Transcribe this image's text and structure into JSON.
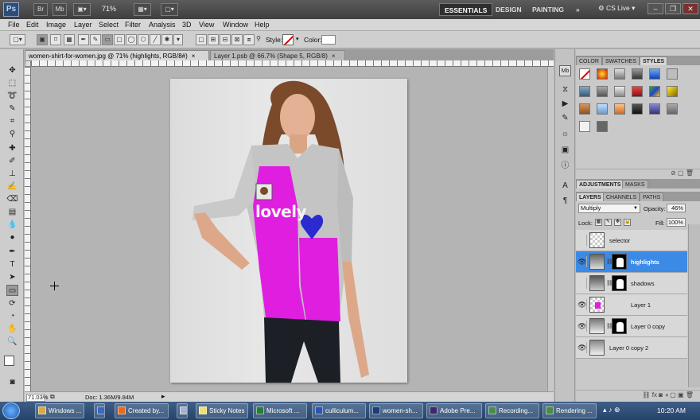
{
  "appbar": {
    "logo": "Ps",
    "zoom": "71%",
    "workspaces": [
      "ESSENTIALS",
      "DESIGN",
      "PAINTING"
    ],
    "more": "»",
    "cs_live": "CS Live"
  },
  "menu": [
    "File",
    "Edit",
    "Image",
    "Layer",
    "Select",
    "Filter",
    "Analysis",
    "3D",
    "View",
    "Window",
    "Help"
  ],
  "options": {
    "style_label": "Style:",
    "color_label": "Color:",
    "color_value": "#ffffff"
  },
  "documents": {
    "tabs": [
      {
        "title": "women-shirt-for-women.jpg @ 71% (highlights, RGB/8#)",
        "close": "×"
      },
      {
        "title": "Layer 1.psb @ 66.7% (Shape 5, RGB/8)",
        "close": "×"
      }
    ]
  },
  "canvas": {
    "shirt_text": "lovely"
  },
  "status": {
    "zoom": "71.03%",
    "doc": "Doc: 1.36M/9.84M"
  },
  "panels": {
    "top_tabs": [
      "COLOR",
      "SWATCHES",
      "STYLES"
    ],
    "adj_tabs": [
      "ADJUSTMENTS",
      "MASKS"
    ],
    "layer_tabs": [
      "LAYERS",
      "CHANNELS",
      "PATHS"
    ],
    "blend_mode": "Multiply",
    "opacity_label": "Opacity:",
    "opacity": "46%",
    "lock_label": "Lock:",
    "fill_label": "Fill:",
    "fill": "100%",
    "layers": [
      {
        "name": "selector",
        "visible": false,
        "active": false,
        "mask": false
      },
      {
        "name": "highlights",
        "visible": true,
        "active": true,
        "mask": true
      },
      {
        "name": "shadows",
        "visible": false,
        "active": false,
        "mask": true
      },
      {
        "name": "Layer 1",
        "visible": true,
        "active": false,
        "mask": false
      },
      {
        "name": "Layer 0 copy",
        "visible": true,
        "active": false,
        "mask": true
      },
      {
        "name": "Layer 0 copy 2",
        "visible": true,
        "active": false,
        "mask": false
      }
    ]
  },
  "taskbar": {
    "items": [
      "Windows ...",
      "Created by...",
      "Sticky Notes",
      "Microsoft ...",
      "culliculum...",
      "women-sh...",
      "Adobe Pre...",
      "Recording...",
      "Rendering ..."
    ],
    "clock": "10:20 AM"
  },
  "colors": {
    "accent_selected": "#3b8ae6",
    "shirt_magenta": "#e01ee0",
    "heart_blue": "#2a2ad0"
  }
}
